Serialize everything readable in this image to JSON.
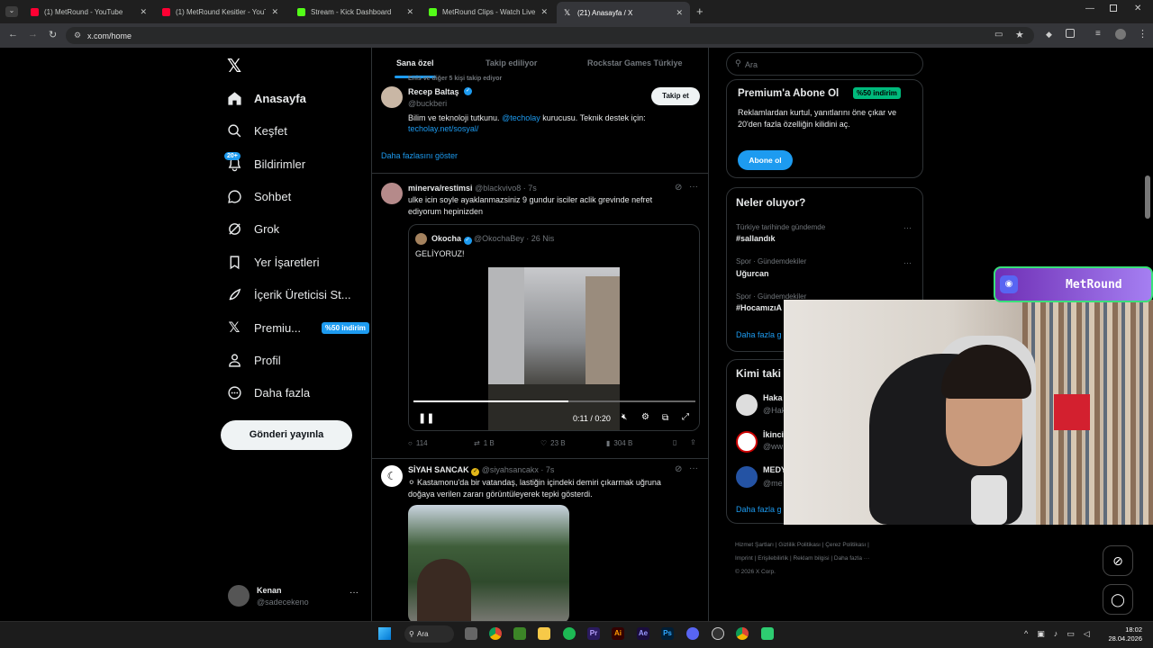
{
  "browser": {
    "tabs": [
      {
        "title": "(1) MetRound - YouTube",
        "color": "#ff0033"
      },
      {
        "title": "(1) MetRound Kesitler - YouTube",
        "color": "#ff0033"
      },
      {
        "title": "Stream - Kick Dashboard",
        "color": "#53fc18"
      },
      {
        "title": "MetRound Clips - Watch Live on Kick",
        "color": "#53fc18"
      },
      {
        "title": "(21) Anasayfa / X",
        "color": "#ffffff"
      }
    ],
    "url": "x.com/home"
  },
  "sidebar": {
    "items": [
      {
        "label": "Anasayfa",
        "icon": "home-icon"
      },
      {
        "label": "Keşfet",
        "icon": "search-icon"
      },
      {
        "label": "Bildirimler",
        "icon": "bell-icon",
        "badge": "20+"
      },
      {
        "label": "Sohbet",
        "icon": "chat-icon"
      },
      {
        "label": "Grok",
        "icon": "grok-icon"
      },
      {
        "label": "Yer İşaretleri",
        "icon": "bookmark-icon"
      },
      {
        "label": "İçerik Üreticisi St...",
        "icon": "rocket-icon"
      },
      {
        "label": "Premiu...",
        "icon": "x-icon",
        "badge": "%50 indirim"
      },
      {
        "label": "Profil",
        "icon": "person-icon"
      },
      {
        "label": "Daha fazla",
        "icon": "more-circle-icon"
      }
    ],
    "post_button": "Gönderi yayınla",
    "account": {
      "name": "Kenan",
      "handle": "@sadecekeno"
    }
  },
  "feed": {
    "tabs": [
      "Sana özel",
      "Takip ediliyor",
      "Rockstar Games Türkiye"
    ],
    "suggestion": {
      "context": "Enis ve diğer 5 kişi takip ediyor",
      "name": "Recep Baltaş",
      "handle": "@buckberi",
      "follow": "Takip et",
      "bio_1": "Bilim ve teknoloji tutkunu.",
      "bio_mention": "@techolay",
      "bio_2": "kurucusu. Teknik destek için:",
      "bio_link": "techolay.net/sosyal/",
      "show_more": "Daha fazlasını göster"
    },
    "post1": {
      "name": "minerva/restimsi",
      "handle": "@blackvivo8",
      "time": "· 7s",
      "text": "ulke icin soyle ayaklanmazsiniz 9 gundur isciler aclik grevinde nefret ediyorum hepinizden",
      "quote": {
        "name": "Okocha",
        "handle": "@OkochaBey",
        "time": "· 26 Nis",
        "text": "GELİYORUZ!"
      },
      "video_time": "0:11 / 0:20",
      "progress": 0.55,
      "replies": "114",
      "reposts": "1 B",
      "likes": "23 B",
      "views": "304 B"
    },
    "post2": {
      "name": "SİYAH SANCAK",
      "handle": "@siyahsancakx",
      "time": "· 7s",
      "text": "⚪ Kastamonu'da bir vatandaş, lastiğin içindeki demiri çıkarmak uğruna doğaya verilen zararı görüntüleyerek tepki gösterdi."
    }
  },
  "right": {
    "search_placeholder": "Ara",
    "premium": {
      "title": "Premium'a Abone Ol",
      "badge": "%50 indirim",
      "text": "Reklamlardan kurtul, yanıtlarını öne çıkar ve 20'den fazla özelliğin kilidini aç.",
      "button": "Abone ol"
    },
    "trends": {
      "title": "Neler oluyor?",
      "items": [
        {
          "context": "Türkiye tarihinde gündemde",
          "tag": "#sallandık"
        },
        {
          "context": "Spor · Gündemdekiler",
          "tag": "Uğurcan"
        },
        {
          "context": "Spor · Gündemdekiler",
          "tag": "#HocamızıA"
        }
      ],
      "more": "Daha fazla g"
    },
    "who": {
      "title": "Kimi taki",
      "items": [
        {
          "name": "Haka",
          "handle": "@Hak"
        },
        {
          "name": "İkinci",
          "handle": "@ww"
        },
        {
          "name": "MEDY",
          "handle": "@me"
        }
      ],
      "more": "Daha fazla g"
    },
    "footer": [
      "Hizmet Şartları",
      "Gizlilik Politikası",
      "Çerez Politikası",
      "Imprint",
      "Erişilebilirlik",
      "Reklam bilgisi",
      "Daha fazla ···",
      "© 2026 X Corp."
    ]
  },
  "overlay": {
    "streamer_name": "MetRound"
  },
  "taskbar": {
    "search": "Ara",
    "time": "18:02",
    "date": "28.04.2026"
  }
}
